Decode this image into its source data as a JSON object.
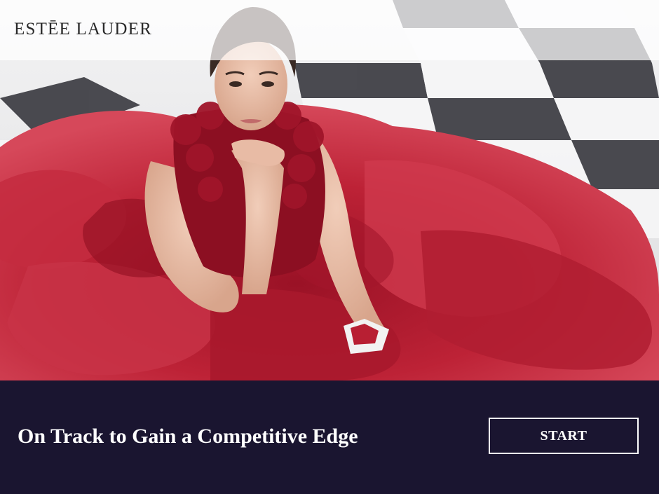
{
  "brand": {
    "logo_text": "ESTĒE LAUDER"
  },
  "hero": {
    "image_subject": "model-in-red-gown-photo",
    "palette": {
      "gown": "#b81f33",
      "gown_dark": "#7e0f20",
      "floor_light": "#f4f4f5",
      "floor_dark": "#3a3a40",
      "skin": "#e4b8a2",
      "hair": "#3a2a24"
    }
  },
  "footer": {
    "headline": "On Track to Gain a Competitive Edge",
    "start_label": "START",
    "background": "#1a1530",
    "text_color": "#ffffff"
  }
}
